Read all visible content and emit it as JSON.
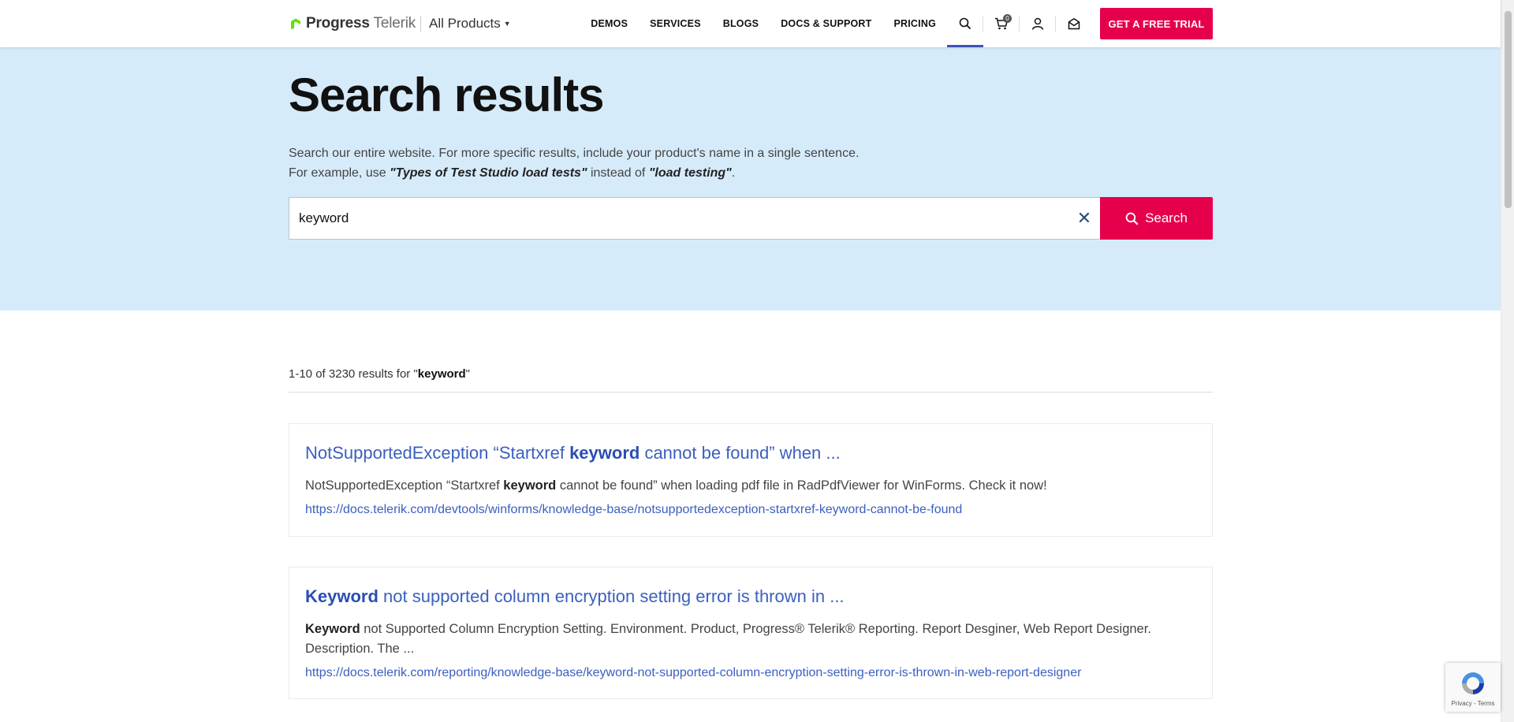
{
  "header": {
    "logo_brand": "Progress",
    "logo_product": "Telerik",
    "products_menu": "All Products",
    "nav": [
      "DEMOS",
      "SERVICES",
      "BLOGS",
      "DOCS & SUPPORT",
      "PRICING"
    ],
    "cart_count": "0",
    "trial_button": "GET A FREE TRIAL"
  },
  "hero": {
    "title": "Search results",
    "desc_line1": "Search our entire website. For more specific results, include your product's name in a single sentence.",
    "desc_line2_prefix": "For example, use ",
    "desc_example_good": "\"Types of Test Studio load tests\"",
    "desc_line2_middle": " instead of ",
    "desc_example_bad": "\"load testing\"",
    "desc_line2_suffix": ".",
    "search_value": "keyword",
    "search_button": "Search"
  },
  "results": {
    "range": "1-10",
    "of": "of",
    "total": "3230",
    "results_for": "results for",
    "query": "keyword",
    "items": [
      {
        "title_pre": "NotSupportedException “Startxref ",
        "title_bold": "keyword",
        "title_post": " cannot be found” when ...",
        "snippet_pre": "NotSupportedException “Startxref ",
        "snippet_bold": "keyword",
        "snippet_post": " cannot be found” when loading pdf file in RadPdfViewer for WinForms. Check it now!",
        "url": "https://docs.telerik.com/devtools/winforms/knowledge-base/notsupportedexception-startxref-keyword-cannot-be-found"
      },
      {
        "title_pre": "",
        "title_bold": "Keyword",
        "title_post": " not supported column encryption setting error is thrown in ...",
        "snippet_pre": "",
        "snippet_bold": "Keyword",
        "snippet_post": " not Supported Column Encryption Setting. Environment. Product, Progress® Telerik® Reporting. Report Desginer, Web Report Designer. Description. The ...",
        "url": "https://docs.telerik.com/reporting/knowledge-base/keyword-not-supported-column-encryption-setting-error-is-thrown-in-web-report-designer"
      }
    ]
  },
  "recaptcha": {
    "links": "Privacy - Terms"
  },
  "colors": {
    "accent": "#e6004c",
    "hero_bg": "#d6ebfa",
    "link": "#3b5fc0",
    "active_underline": "#3f51b5"
  },
  "icons": [
    "progress-logo-icon",
    "search-icon",
    "cart-icon",
    "user-icon",
    "mail-icon",
    "clear-icon",
    "recaptcha-icon"
  ]
}
